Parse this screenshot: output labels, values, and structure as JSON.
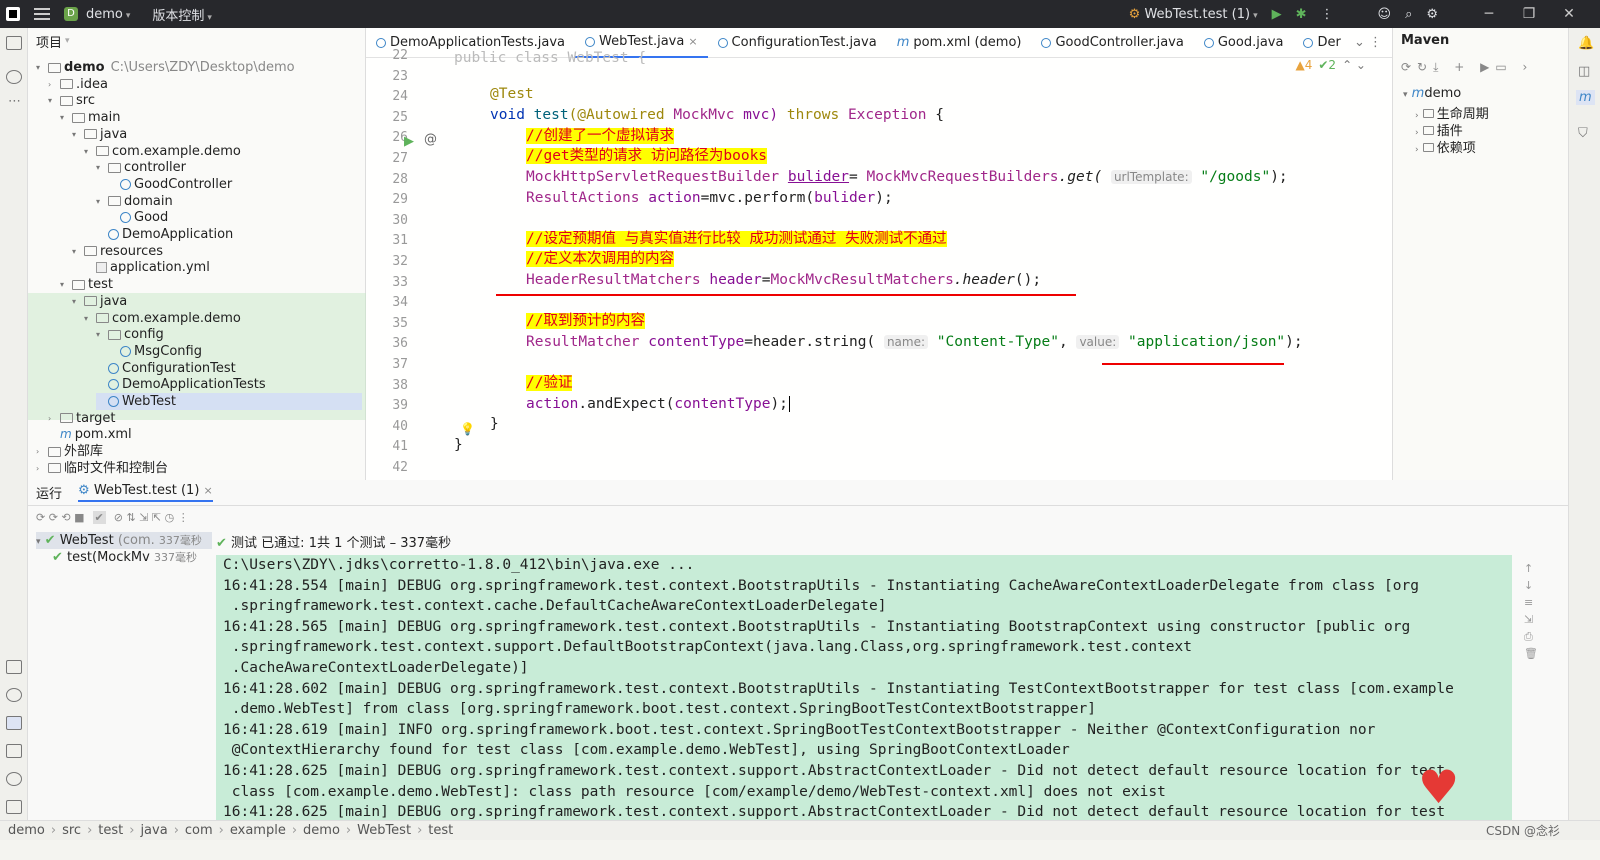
{
  "titlebar": {
    "project": "demo",
    "project_badge": "D",
    "vcs": "版本控制",
    "run_config": "WebTest.test (1)"
  },
  "project_panel": {
    "title": "项目",
    "tree": [
      {
        "label": "demo",
        "extra": "C:\\Users\\ZDY\\Desktop\\demo",
        "depth": 0,
        "icon": "folder-icon",
        "arrow": "▾"
      },
      {
        "label": ".idea",
        "depth": 1,
        "icon": "folder-icon",
        "arrow": "›"
      },
      {
        "label": "src",
        "depth": 1,
        "icon": "folder-icon",
        "arrow": "▾"
      },
      {
        "label": "main",
        "depth": 2,
        "icon": "folder-icon",
        "arrow": "▾"
      },
      {
        "label": "java",
        "depth": 3,
        "icon": "folder-icon",
        "arrow": "▾"
      },
      {
        "label": "com.example.demo",
        "depth": 4,
        "icon": "folder-icon",
        "arrow": "▾"
      },
      {
        "label": "controller",
        "depth": 5,
        "icon": "folder-icon",
        "arrow": "▾"
      },
      {
        "label": "GoodController",
        "depth": 6,
        "icon": "class-icon",
        "arrow": ""
      },
      {
        "label": "domain",
        "depth": 5,
        "icon": "folder-icon",
        "arrow": "▾"
      },
      {
        "label": "Good",
        "depth": 6,
        "icon": "class-icon",
        "arrow": ""
      },
      {
        "label": "DemoApplication",
        "depth": 5,
        "icon": "class-icon",
        "arrow": ""
      },
      {
        "label": "resources",
        "depth": 3,
        "icon": "folder-icon",
        "arrow": "▾"
      },
      {
        "label": "application.yml",
        "depth": 4,
        "icon": "yml-icon",
        "arrow": ""
      },
      {
        "label": "test",
        "depth": 2,
        "icon": "folder-icon",
        "arrow": "▾"
      },
      {
        "label": "java",
        "depth": 3,
        "icon": "folder-icon",
        "arrow": "▾"
      },
      {
        "label": "com.example.demo",
        "depth": 4,
        "icon": "folder-icon",
        "arrow": "▾"
      },
      {
        "label": "config",
        "depth": 5,
        "icon": "folder-icon",
        "arrow": "▾"
      },
      {
        "label": "MsgConfig",
        "depth": 6,
        "icon": "class-icon",
        "arrow": ""
      },
      {
        "label": "ConfigurationTest",
        "depth": 5,
        "icon": "class-icon",
        "arrow": ""
      },
      {
        "label": "DemoApplicationTests",
        "depth": 5,
        "icon": "class-icon",
        "arrow": ""
      },
      {
        "label": "WebTest",
        "depth": 5,
        "icon": "class-icon",
        "arrow": "",
        "selected": true
      },
      {
        "label": "target",
        "depth": 1,
        "icon": "folder-icon",
        "arrow": "›"
      },
      {
        "label": "pom.xml",
        "depth": 1,
        "icon": "maven-icon",
        "arrow": ""
      },
      {
        "label": "外部库",
        "depth": 0,
        "icon": "library-icon",
        "arrow": "›"
      },
      {
        "label": "临时文件和控制台",
        "depth": 0,
        "icon": "scratch-icon",
        "arrow": "›"
      }
    ]
  },
  "editor": {
    "tabs": [
      {
        "label": "DemoApplicationTests.java",
        "icon": "class-icon"
      },
      {
        "label": "WebTest.java",
        "icon": "class-icon",
        "active": true
      },
      {
        "label": "ConfigurationTest.java",
        "icon": "class-icon"
      },
      {
        "label": "pom.xml (demo)",
        "icon": "maven-icon"
      },
      {
        "label": "GoodController.java",
        "icon": "class-icon"
      },
      {
        "label": "Good.java",
        "icon": "class-icon"
      },
      {
        "label": "Der",
        "icon": "class-icon"
      }
    ],
    "inspections": {
      "warnings": "▲4",
      "weak": "✔2"
    },
    "line_numbers": [
      "22",
      "23",
      "24",
      "25",
      "26",
      "27",
      "28",
      "29",
      "30",
      "31",
      "32",
      "33",
      "34",
      "35",
      "36",
      "37",
      "38",
      "39",
      "40",
      "41",
      "42"
    ],
    "code": {
      "l22": "public class WebTest {",
      "l24_ann": "@Test",
      "l25_void": "void ",
      "l25_name": "test",
      "l25_param_ann": "(@Autowired ",
      "l25_type": "MockMvc",
      "l25_var": " mvc) ",
      "l25_throws": "throws ",
      "l25_exc": "Exception",
      "l25_end": " {",
      "c26": "//创建了一个虚拟请求",
      "c27": "//get类型的请求 访问路径为books",
      "l28_type": "MockHttpServletRequestBuilder",
      "l28_var": "bulider",
      "l28_eq": "= ",
      "l28_cls": "MockMvcRequestBuilders",
      "l28_get": ".get(",
      "l28_hint": "urlTemplate:",
      "l28_str": "\"/goods\"",
      "l28_end": ");",
      "l29_type": "ResultActions",
      "l29_var": "action",
      "l29_mid": "=mvc.perform(",
      "l29_arg": "bulider",
      "l29_end": ");",
      "c31": "//设定预期值 与真实值进行比较 成功测试通过 失败测试不通过",
      "c32": "//定义本次调用的内容",
      "l33_type": "HeaderResultMatchers",
      "l33_var": "header",
      "l33_eq": "=",
      "l33_cls": "MockMvcResultMatchers",
      "l33_call": ".header",
      "l33_end": "();",
      "c35": "//取到预计的内容",
      "l36_type": "ResultMatcher",
      "l36_var": "contentType",
      "l36_mid": "=header.string(",
      "l36_hint1": "name:",
      "l36_str1": "\"Content-Type\"",
      "l36_comma": ", ",
      "l36_hint2": "value:",
      "l36_str2": "\"application/json\"",
      "l36_end": ");",
      "c38": "//验证",
      "l39_a": "action",
      "l39_b": ".andExpect(",
      "l39_c": "contentType",
      "l39_d": ");",
      "l40": "}",
      "l41": "}"
    }
  },
  "maven": {
    "title": "Maven",
    "items": [
      {
        "label": "demo",
        "depth": 0
      },
      {
        "label": "生命周期",
        "depth": 1
      },
      {
        "label": "插件",
        "depth": 1
      },
      {
        "label": "依赖项",
        "depth": 1
      }
    ]
  },
  "run": {
    "tab_run": "运行",
    "tab_test": "WebTest.test (1)",
    "tree_root": "WebTest",
    "tree_root_detail": "(com.",
    "tree_root_time": "337毫秒",
    "tree_child": "test(MockMv",
    "tree_child_time": "337毫秒",
    "status": "测试 已通过: 1共 1 个测试 – 337毫秒",
    "console": [
      "C:\\Users\\ZDY\\.jdks\\corretto-1.8.0_412\\bin\\java.exe ...",
      "16:41:28.554 [main] DEBUG org.springframework.test.context.BootstrapUtils - Instantiating CacheAwareContextLoaderDelegate from class [org",
      " .springframework.test.context.cache.DefaultCacheAwareContextLoaderDelegate]",
      "16:41:28.565 [main] DEBUG org.springframework.test.context.BootstrapUtils - Instantiating BootstrapContext using constructor [public org",
      " .springframework.test.context.support.DefaultBootstrapContext(java.lang.Class,org.springframework.test.context",
      " .CacheAwareContextLoaderDelegate)]",
      "16:41:28.602 [main] DEBUG org.springframework.test.context.BootstrapUtils - Instantiating TestContextBootstrapper for test class [com.example",
      " .demo.WebTest] from class [org.springframework.boot.test.context.SpringBootTestContextBootstrapper]",
      "16:41:28.619 [main] INFO org.springframework.boot.test.context.SpringBootTestContextBootstrapper - Neither @ContextConfiguration nor",
      " @ContextHierarchy found for test class [com.example.demo.WebTest], using SpringBootContextLoader",
      "16:41:28.625 [main] DEBUG org.springframework.test.context.support.AbstractContextLoader - Did not detect default resource location for test",
      " class [com.example.demo.WebTest]: class path resource [com/example/demo/WebTest-context.xml] does not exist",
      "16:41:28.625 [main] DEBUG org.springframework.test.context.support.AbstractContextLoader - Did not detect default resource location for test"
    ]
  },
  "breadcrumb": [
    "demo",
    "src",
    "test",
    "java",
    "com",
    "example",
    "demo",
    "WebTest",
    "test"
  ],
  "watermark": "CSDN @念衫"
}
